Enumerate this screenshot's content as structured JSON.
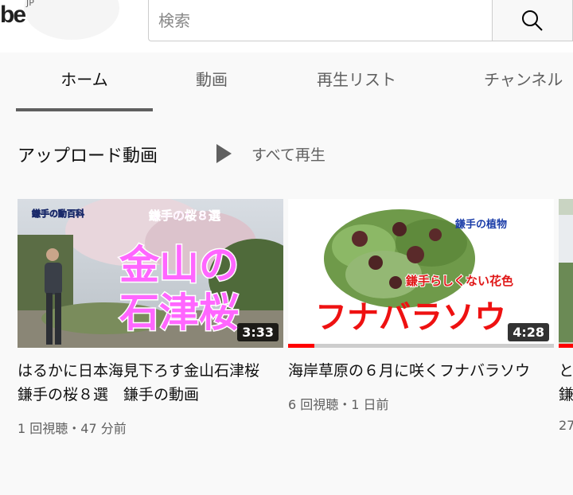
{
  "header": {
    "logo_text": "be",
    "logo_region": "JP",
    "search_placeholder": "検索",
    "search_icon": "search-icon"
  },
  "tabs": [
    {
      "label": "ホーム",
      "active": true
    },
    {
      "label": "動画",
      "active": false
    },
    {
      "label": "再生リスト",
      "active": false
    },
    {
      "label": "チャンネル",
      "active": false
    }
  ],
  "section": {
    "title": "アップロード動画",
    "play_all_label": "すべて再生",
    "play_icon": "play-icon"
  },
  "videos": [
    {
      "title": "はるかに日本海見下ろす金山石津桜 鎌手の桜８選　鎌手の動画",
      "meta": "1 回視聴・47 分前",
      "duration": "3:33",
      "thumb_text": {
        "channel": "鎌手の動百科",
        "series": "鎌手の桜８選",
        "line1": "金山の",
        "line2": "石津桜"
      }
    },
    {
      "title": "海岸草原の６月に咲くフナバラソウ",
      "meta": "6 回視聴・1 日前",
      "duration": "4:28",
      "progress": 0.1,
      "thumb_text": {
        "tag": "鎌手の植物",
        "sub": "鎌手らしくない花色",
        "main": "フナバラソウ"
      }
    },
    {
      "title": "と鎌",
      "meta": "27"
    }
  ],
  "colors": {
    "accent": "#ff0000",
    "text_secondary": "#606060",
    "thumb1_text": "#ff66ff",
    "thumb2_main": "#ee1111"
  }
}
